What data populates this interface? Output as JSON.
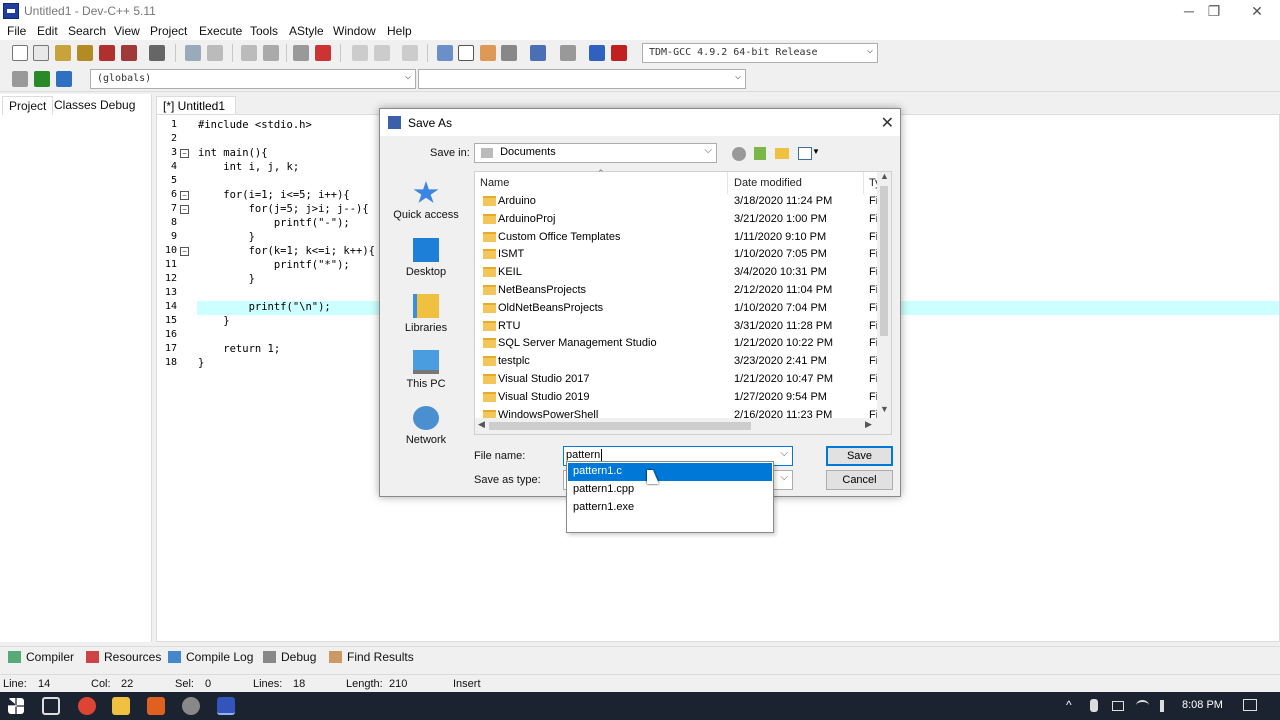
{
  "window": {
    "title": "Untitled1 - Dev-C++ 5.11",
    "controls": [
      "─",
      "❐",
      "✕"
    ]
  },
  "menu": [
    "File",
    "Edit",
    "Search",
    "View",
    "Project",
    "Execute",
    "Tools",
    "AStyle",
    "Window",
    "Help"
  ],
  "toolbar": {
    "compiler_select": "TDM-GCC 4.9.2 64-bit Release",
    "scope_select": "(globals)"
  },
  "left_panel": {
    "tabs": [
      "Project",
      "Classes",
      "Debug"
    ]
  },
  "editor": {
    "tab_label": "[*] Untitled1",
    "lines": [
      {
        "n": "1",
        "code": "#include <stdio.h>"
      },
      {
        "n": "2",
        "code": ""
      },
      {
        "n": "3",
        "code": "int main(){"
      },
      {
        "n": "4",
        "code": "    int i, j, k;"
      },
      {
        "n": "5",
        "code": ""
      },
      {
        "n": "6",
        "code": "    for(i=1; i<=5; i++){"
      },
      {
        "n": "7",
        "code": "        for(j=5; j>i; j--){"
      },
      {
        "n": "8",
        "code": "            printf(\"-\");"
      },
      {
        "n": "9",
        "code": "        }"
      },
      {
        "n": "10",
        "code": "        for(k=1; k<=i; k++){"
      },
      {
        "n": "11",
        "code": "            printf(\"*\");"
      },
      {
        "n": "12",
        "code": "        }"
      },
      {
        "n": "13",
        "code": ""
      },
      {
        "n": "14",
        "code": "        printf(\"\\n\");"
      },
      {
        "n": "15",
        "code": "    }"
      },
      {
        "n": "16",
        "code": ""
      },
      {
        "n": "17",
        "code": "    return 1;"
      },
      {
        "n": "18",
        "code": "}"
      }
    ]
  },
  "bottom_tabs": [
    "Compiler",
    "Resources",
    "Compile Log",
    "Debug",
    "Find Results"
  ],
  "status": {
    "line_label": "Line:",
    "line": "14",
    "col_label": "Col:",
    "col": "22",
    "sel_label": "Sel:",
    "sel": "0",
    "lines_label": "Lines:",
    "lines": "18",
    "length_label": "Length:",
    "length": "210",
    "mode": "Insert"
  },
  "dialog": {
    "title": "Save As",
    "save_in_label": "Save in:",
    "save_in_value": "Documents",
    "places": [
      "Quick access",
      "Desktop",
      "Libraries",
      "This PC",
      "Network"
    ],
    "columns": {
      "name": "Name",
      "date": "Date modified",
      "type": "Ty"
    },
    "files": [
      {
        "name": "Arduino",
        "date": "3/18/2020 11:24 PM",
        "type": "Fil"
      },
      {
        "name": "ArduinoProj",
        "date": "3/21/2020 1:00 PM",
        "type": "Fil"
      },
      {
        "name": "Custom Office Templates",
        "date": "1/11/2020 9:10 PM",
        "type": "Fil"
      },
      {
        "name": "ISMT",
        "date": "1/10/2020 7:05 PM",
        "type": "Fil"
      },
      {
        "name": "KEIL",
        "date": "3/4/2020 10:31 PM",
        "type": "Fil"
      },
      {
        "name": "NetBeansProjects",
        "date": "2/12/2020 11:04 PM",
        "type": "Fil"
      },
      {
        "name": "OldNetBeansProjects",
        "date": "1/10/2020 7:04 PM",
        "type": "Fil"
      },
      {
        "name": "RTU",
        "date": "3/31/2020 11:28 PM",
        "type": "Fil"
      },
      {
        "name": "SQL Server Management Studio",
        "date": "1/21/2020 10:22 PM",
        "type": "Fil"
      },
      {
        "name": "testplc",
        "date": "3/23/2020 2:41 PM",
        "type": "Fil"
      },
      {
        "name": "Visual Studio 2017",
        "date": "1/21/2020 10:47 PM",
        "type": "Fil"
      },
      {
        "name": "Visual Studio 2019",
        "date": "1/27/2020 9:54 PM",
        "type": "Fil"
      },
      {
        "name": "WindowsPowerShell",
        "date": "2/16/2020 11:23 PM",
        "type": "Fil"
      }
    ],
    "file_name_label": "File name:",
    "file_name_value": "pattern",
    "save_as_type_label": "Save as type:",
    "save_button": "Save",
    "cancel_button": "Cancel",
    "autocomplete": [
      "pattern1.c",
      "pattern1.cpp",
      "pattern1.exe"
    ]
  },
  "taskbar": {
    "time": "8:08 PM"
  }
}
